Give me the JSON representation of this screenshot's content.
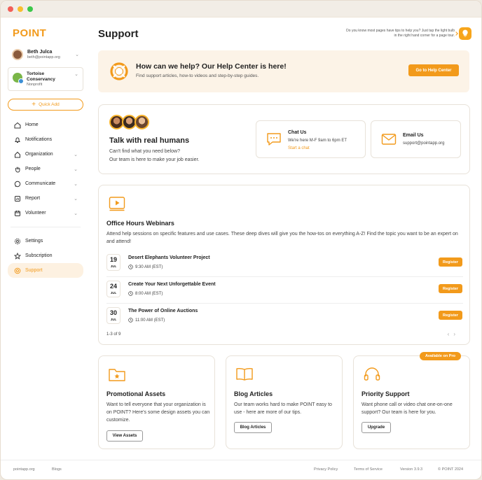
{
  "brand": {
    "logo": "POINT",
    "accent": "#f29a1b"
  },
  "user": {
    "name": "Beth Julca",
    "email": "beth@pointapp.org"
  },
  "org": {
    "name_line1": "Tortoise",
    "name_line2": "Conservancy",
    "type": "Nonprofit"
  },
  "sidebar": {
    "quick_add": "Quick Add",
    "items": [
      {
        "label": "Home",
        "icon": "home-icon"
      },
      {
        "label": "Notifications",
        "icon": "bell-icon"
      },
      {
        "label": "Organization",
        "icon": "building-icon"
      },
      {
        "label": "People",
        "icon": "hand-icon"
      },
      {
        "label": "Communicate",
        "icon": "chat-icon"
      },
      {
        "label": "Report",
        "icon": "report-icon"
      },
      {
        "label": "Volunteer",
        "icon": "calendar-icon"
      },
      {
        "label": "Settings",
        "icon": "gear-icon"
      },
      {
        "label": "Subscription",
        "icon": "star-icon"
      },
      {
        "label": "Support",
        "icon": "lifebuoy-icon"
      }
    ]
  },
  "header": {
    "title": "Support",
    "tip": "Do you know most pages have tips to help you? Just tap the light bulb in the right hand corner for a page tour."
  },
  "banner": {
    "title": "How can we help? Our Help Center is here!",
    "subtitle": "Find support articles, how-to videos and step-by-step guides.",
    "button": "Go to Help Center"
  },
  "talk": {
    "title": "Talk with real humans",
    "line1": "Can't find what you need below?",
    "line2": "Our team is here to make your job easier.",
    "chat": {
      "title": "Chat Us",
      "hours": "We're here M-F  9am to 6pm ET",
      "link": "Start a chat"
    },
    "email": {
      "title": "Email Us",
      "address": "support@pointapp.org"
    }
  },
  "webinars": {
    "title": "Office Hours Webinars",
    "description": "Attend help sessions on specific features and use cases. These deep dives will give you the how-tos on everything A-Z! Find the topic you want to be an expert on and attend!",
    "register": "Register",
    "events": [
      {
        "day": "19",
        "month": "JUL",
        "name": "Desert Elephants Volunteer Project",
        "time": "9:30 AM (EST)"
      },
      {
        "day": "24",
        "month": "JUL",
        "name": "Create Your Next Unforgettable Event",
        "time": "8:00 AM (EST)"
      },
      {
        "day": "30",
        "month": "JUL",
        "name": "The Power of Online Auctions",
        "time": "11:00 AM (EST)"
      }
    ],
    "pager": "1-3 of 9"
  },
  "resources": [
    {
      "title": "Promotional Assets",
      "desc": "Want to tell everyone that your organization is on POINT? Here's some design assets you can customize.",
      "button": "View Assets"
    },
    {
      "title": "Blog Articles",
      "desc": "Our team works hard to make POINT easy to use - here are more of our tips.",
      "button": "Blog Articles"
    },
    {
      "title": "Priority Support",
      "desc": "Want phone call or video chat one-on-one support? Our team is here for you.",
      "button": "Upgrade",
      "badge": "Available on Pro"
    }
  ],
  "footer": {
    "site": "pointapp.org",
    "blogs": "Blogs",
    "privacy": "Privacy Policy",
    "terms": "Terms of Service",
    "version": "Version 3.9.3",
    "copyright": "© POINT 2024"
  }
}
